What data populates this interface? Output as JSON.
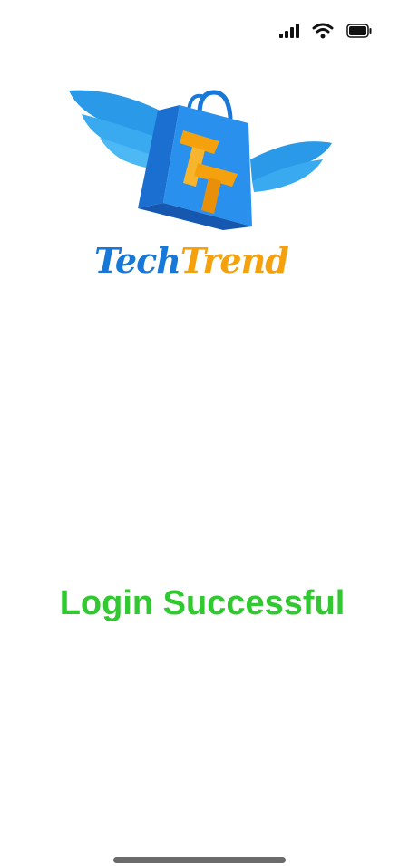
{
  "status_bar": {
    "icons": [
      "cellular-signal-icon",
      "wifi-icon",
      "battery-icon"
    ]
  },
  "logo": {
    "brand_part1": "Tech",
    "brand_part2": "Trend",
    "colors": {
      "blue": "#1878d8",
      "orange": "#f5a10d"
    }
  },
  "message": {
    "text": "Login Successful",
    "color": "#32c832"
  }
}
